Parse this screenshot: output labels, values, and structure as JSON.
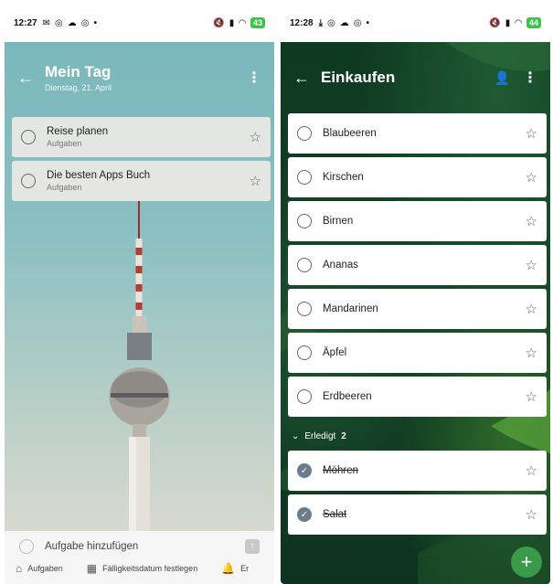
{
  "left": {
    "status": {
      "time": "12:27",
      "battery": "43"
    },
    "header": {
      "title": "Mein Tag",
      "subtitle": "Dienstag, 21. April"
    },
    "tasks": [
      {
        "title": "Reise planen",
        "list": "Aufgaben"
      },
      {
        "title": "Die besten Apps Buch",
        "list": "Aufgaben"
      }
    ],
    "add_task_placeholder": "Aufgabe hinzufügen",
    "toolbar": {
      "tasks": "Aufgaben",
      "due_date": "Fälligkeitsdatum festlegen",
      "reminder": "Er"
    }
  },
  "right": {
    "status": {
      "time": "12:28",
      "battery": "44"
    },
    "header": {
      "title": "Einkaufen"
    },
    "tasks": [
      {
        "title": "Blaubeeren"
      },
      {
        "title": "Kirschen"
      },
      {
        "title": "Birnen"
      },
      {
        "title": "Ananas"
      },
      {
        "title": "Mandarinen"
      },
      {
        "title": "Äpfel"
      },
      {
        "title": "Erdbeeren"
      }
    ],
    "completed": {
      "label": "Erledigt",
      "count": "2"
    },
    "completed_tasks": [
      {
        "title": "Möhren"
      },
      {
        "title": "Salat"
      }
    ]
  },
  "icons": {
    "back": "arrow-left-icon",
    "more": "more-vertical-icon",
    "star": "star-outline-icon",
    "share": "share-person-icon",
    "add": "plus-icon",
    "home": "home-icon",
    "calendar": "calendar-icon",
    "bell": "bell-icon"
  },
  "colors": {
    "accent_green": "#3a9a4a",
    "check_gray": "#6b7b8c",
    "battery": "#3ec24a"
  }
}
